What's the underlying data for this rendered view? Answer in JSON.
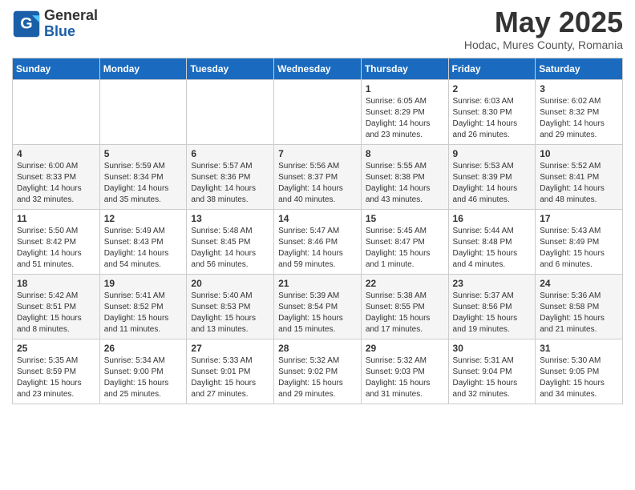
{
  "logo": {
    "general": "General",
    "blue": "Blue"
  },
  "title": "May 2025",
  "subtitle": "Hodac, Mures County, Romania",
  "headers": [
    "Sunday",
    "Monday",
    "Tuesday",
    "Wednesday",
    "Thursday",
    "Friday",
    "Saturday"
  ],
  "weeks": [
    [
      {
        "day": "",
        "info": ""
      },
      {
        "day": "",
        "info": ""
      },
      {
        "day": "",
        "info": ""
      },
      {
        "day": "",
        "info": ""
      },
      {
        "day": "1",
        "info": "Sunrise: 6:05 AM\nSunset: 8:29 PM\nDaylight: 14 hours\nand 23 minutes."
      },
      {
        "day": "2",
        "info": "Sunrise: 6:03 AM\nSunset: 8:30 PM\nDaylight: 14 hours\nand 26 minutes."
      },
      {
        "day": "3",
        "info": "Sunrise: 6:02 AM\nSunset: 8:32 PM\nDaylight: 14 hours\nand 29 minutes."
      }
    ],
    [
      {
        "day": "4",
        "info": "Sunrise: 6:00 AM\nSunset: 8:33 PM\nDaylight: 14 hours\nand 32 minutes."
      },
      {
        "day": "5",
        "info": "Sunrise: 5:59 AM\nSunset: 8:34 PM\nDaylight: 14 hours\nand 35 minutes."
      },
      {
        "day": "6",
        "info": "Sunrise: 5:57 AM\nSunset: 8:36 PM\nDaylight: 14 hours\nand 38 minutes."
      },
      {
        "day": "7",
        "info": "Sunrise: 5:56 AM\nSunset: 8:37 PM\nDaylight: 14 hours\nand 40 minutes."
      },
      {
        "day": "8",
        "info": "Sunrise: 5:55 AM\nSunset: 8:38 PM\nDaylight: 14 hours\nand 43 minutes."
      },
      {
        "day": "9",
        "info": "Sunrise: 5:53 AM\nSunset: 8:39 PM\nDaylight: 14 hours\nand 46 minutes."
      },
      {
        "day": "10",
        "info": "Sunrise: 5:52 AM\nSunset: 8:41 PM\nDaylight: 14 hours\nand 48 minutes."
      }
    ],
    [
      {
        "day": "11",
        "info": "Sunrise: 5:50 AM\nSunset: 8:42 PM\nDaylight: 14 hours\nand 51 minutes."
      },
      {
        "day": "12",
        "info": "Sunrise: 5:49 AM\nSunset: 8:43 PM\nDaylight: 14 hours\nand 54 minutes."
      },
      {
        "day": "13",
        "info": "Sunrise: 5:48 AM\nSunset: 8:45 PM\nDaylight: 14 hours\nand 56 minutes."
      },
      {
        "day": "14",
        "info": "Sunrise: 5:47 AM\nSunset: 8:46 PM\nDaylight: 14 hours\nand 59 minutes."
      },
      {
        "day": "15",
        "info": "Sunrise: 5:45 AM\nSunset: 8:47 PM\nDaylight: 15 hours\nand 1 minute."
      },
      {
        "day": "16",
        "info": "Sunrise: 5:44 AM\nSunset: 8:48 PM\nDaylight: 15 hours\nand 4 minutes."
      },
      {
        "day": "17",
        "info": "Sunrise: 5:43 AM\nSunset: 8:49 PM\nDaylight: 15 hours\nand 6 minutes."
      }
    ],
    [
      {
        "day": "18",
        "info": "Sunrise: 5:42 AM\nSunset: 8:51 PM\nDaylight: 15 hours\nand 8 minutes."
      },
      {
        "day": "19",
        "info": "Sunrise: 5:41 AM\nSunset: 8:52 PM\nDaylight: 15 hours\nand 11 minutes."
      },
      {
        "day": "20",
        "info": "Sunrise: 5:40 AM\nSunset: 8:53 PM\nDaylight: 15 hours\nand 13 minutes."
      },
      {
        "day": "21",
        "info": "Sunrise: 5:39 AM\nSunset: 8:54 PM\nDaylight: 15 hours\nand 15 minutes."
      },
      {
        "day": "22",
        "info": "Sunrise: 5:38 AM\nSunset: 8:55 PM\nDaylight: 15 hours\nand 17 minutes."
      },
      {
        "day": "23",
        "info": "Sunrise: 5:37 AM\nSunset: 8:56 PM\nDaylight: 15 hours\nand 19 minutes."
      },
      {
        "day": "24",
        "info": "Sunrise: 5:36 AM\nSunset: 8:58 PM\nDaylight: 15 hours\nand 21 minutes."
      }
    ],
    [
      {
        "day": "25",
        "info": "Sunrise: 5:35 AM\nSunset: 8:59 PM\nDaylight: 15 hours\nand 23 minutes."
      },
      {
        "day": "26",
        "info": "Sunrise: 5:34 AM\nSunset: 9:00 PM\nDaylight: 15 hours\nand 25 minutes."
      },
      {
        "day": "27",
        "info": "Sunrise: 5:33 AM\nSunset: 9:01 PM\nDaylight: 15 hours\nand 27 minutes."
      },
      {
        "day": "28",
        "info": "Sunrise: 5:32 AM\nSunset: 9:02 PM\nDaylight: 15 hours\nand 29 minutes."
      },
      {
        "day": "29",
        "info": "Sunrise: 5:32 AM\nSunset: 9:03 PM\nDaylight: 15 hours\nand 31 minutes."
      },
      {
        "day": "30",
        "info": "Sunrise: 5:31 AM\nSunset: 9:04 PM\nDaylight: 15 hours\nand 32 minutes."
      },
      {
        "day": "31",
        "info": "Sunrise: 5:30 AM\nSunset: 9:05 PM\nDaylight: 15 hours\nand 34 minutes."
      }
    ]
  ]
}
